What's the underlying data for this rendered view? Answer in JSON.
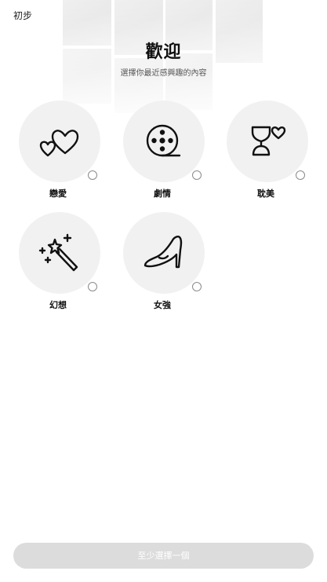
{
  "header": {
    "skip_label": "初步",
    "title": "歡迎",
    "subtitle": "選擇你最近感興趣的內容"
  },
  "genres": [
    {
      "label": "戀愛",
      "icon": "hearts-icon",
      "selected": false
    },
    {
      "label": "劇情",
      "icon": "film-reel-icon",
      "selected": false
    },
    {
      "label": "耽美",
      "icon": "couple-heart-icon",
      "selected": false
    },
    {
      "label": "幻想",
      "icon": "magic-wand-icon",
      "selected": false
    },
    {
      "label": "女強",
      "icon": "high-heel-icon",
      "selected": false
    }
  ],
  "footer": {
    "submit_label": "至少選擇一個"
  },
  "colors": {
    "circle_bg": "#f1f1f1",
    "button_disabled_bg": "#dcdcdc",
    "text_primary": "#111111"
  }
}
